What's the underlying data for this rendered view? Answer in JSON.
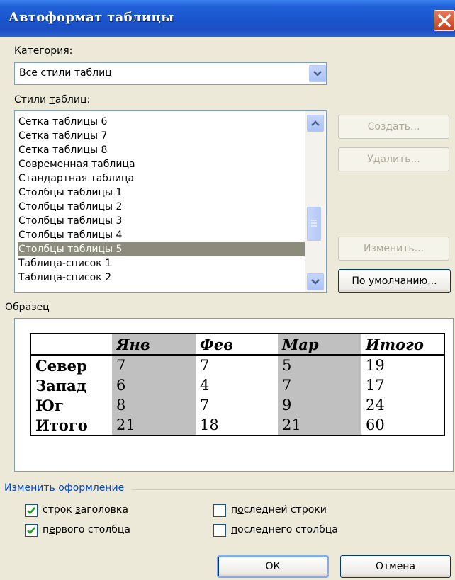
{
  "window": {
    "title": "Автоформат таблицы"
  },
  "category": {
    "label": "Категория:",
    "value": "Все стили таблиц"
  },
  "styles": {
    "label": "Стили таблиц:",
    "items": [
      "Сетка таблицы 6",
      "Сетка таблицы 7",
      "Сетка таблицы 8",
      "Современная таблица",
      "Стандартная таблица",
      "Столбцы таблицы 1",
      "Столбцы таблицы 2",
      "Столбцы таблицы 3",
      "Столбцы таблицы 4",
      "Столбцы таблицы 5",
      "Таблица-список 1",
      "Таблица-список 2"
    ],
    "selected": "Столбцы таблицы 5"
  },
  "buttons": {
    "create": "Создать...",
    "delete": "Удалить...",
    "modify": "Изменить...",
    "default": "По умолчанию...",
    "ok": "ОК",
    "cancel": "Отмена"
  },
  "preview": {
    "label": "Образец",
    "headers": [
      "",
      "Янв",
      "Фев",
      "Мар",
      "Итого"
    ],
    "rows": [
      [
        "Север",
        "7",
        "7",
        "5",
        "19"
      ],
      [
        "Запад",
        "6",
        "4",
        "7",
        "17"
      ],
      [
        "Юг",
        "8",
        "7",
        "9",
        "24"
      ],
      [
        "Итого",
        "21",
        "18",
        "21",
        "60"
      ]
    ]
  },
  "apply": {
    "label": "Изменить оформление",
    "header_rows": {
      "label": "строк заголовка",
      "checked": true
    },
    "first_column": {
      "label": "первого столбца",
      "checked": true
    },
    "last_row": {
      "label": "последней строки",
      "checked": false
    },
    "last_column": {
      "label": "последнего столбца",
      "checked": false
    }
  },
  "colors": {
    "title_bar": "#1c55cc",
    "selection": "#8c8c7c",
    "stripe": "#c0c0c0",
    "group_label": "#0046d5"
  }
}
